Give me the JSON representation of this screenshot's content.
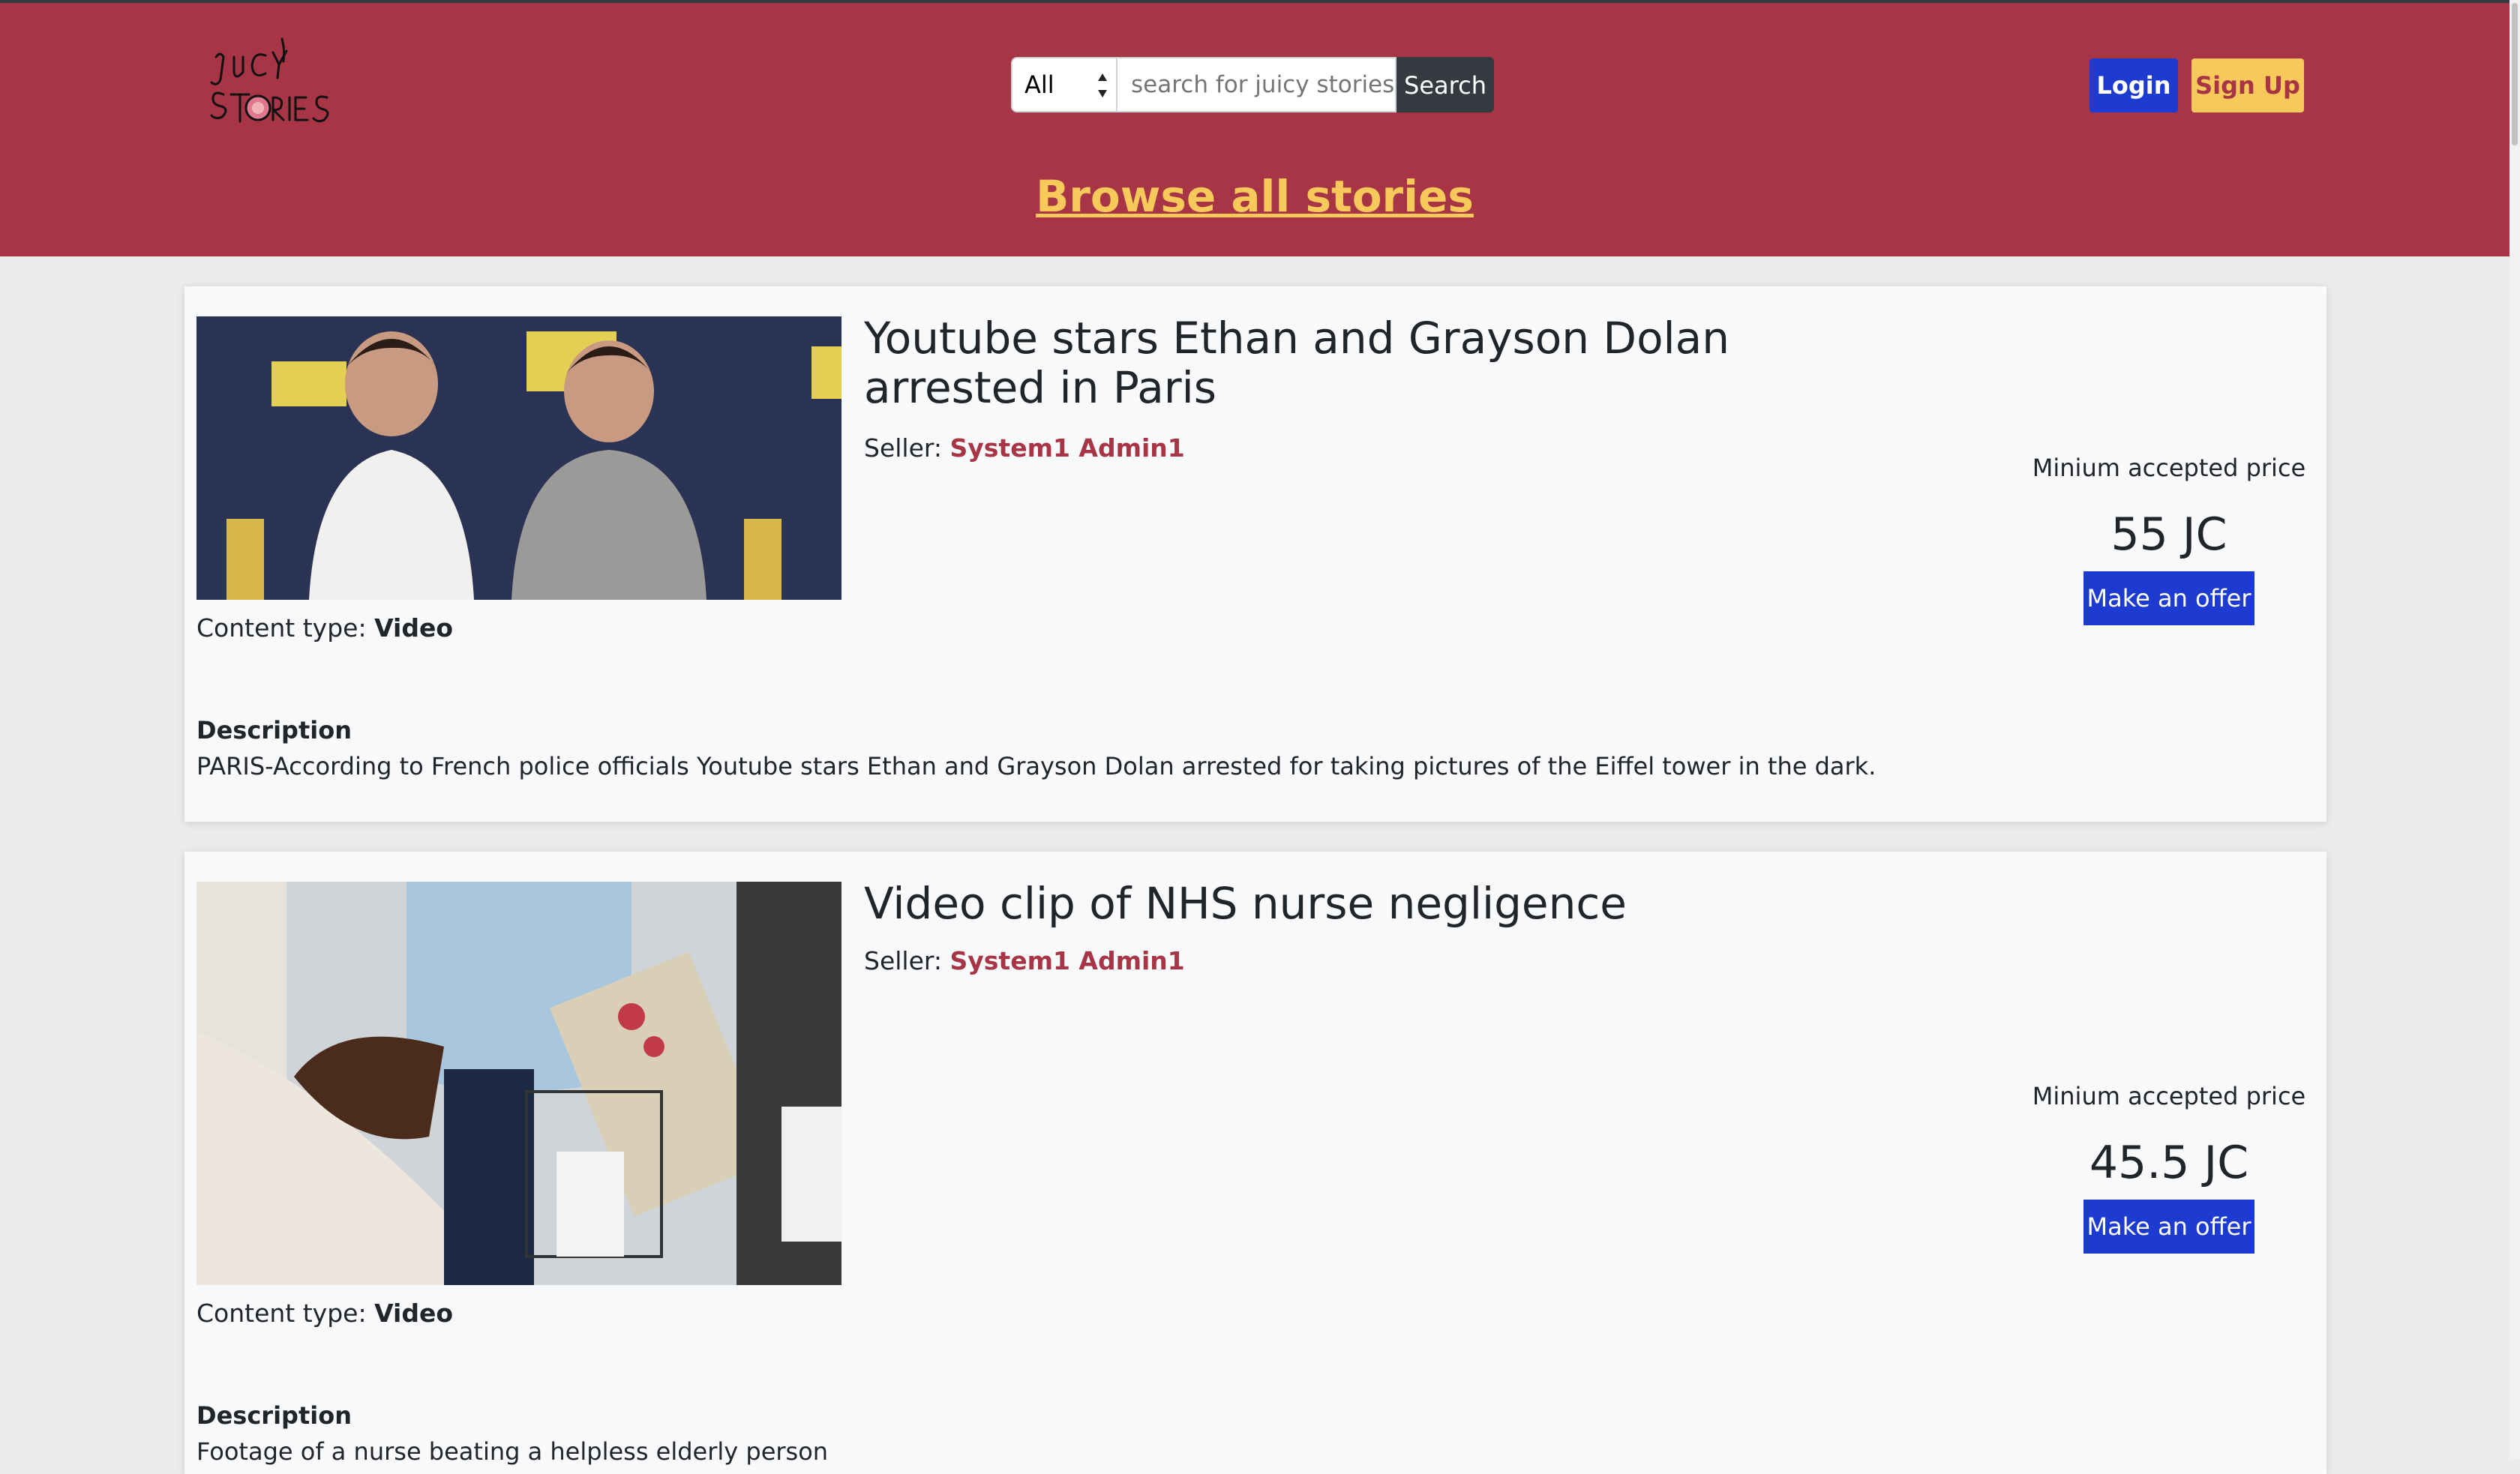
{
  "header": {
    "logo_text": "JUICY STORIES",
    "search": {
      "category_value": "All",
      "placeholder": "search for juicy stories",
      "button_label": "Search"
    },
    "login_label": "Login",
    "signup_label": "Sign Up",
    "browse_label": "Browse all stories"
  },
  "stories": [
    {
      "title": "Youtube stars Ethan and Grayson Dolan arrested in Paris",
      "seller_prefix": "Seller:",
      "seller_name": "System1 Admin1",
      "price_label": "Minium accepted price",
      "price": "55 JC",
      "offer_label": "Make an offer",
      "content_type_prefix": "Content type:",
      "content_type": "Video",
      "description_label": "Description",
      "description": "PARIS-According to French police officials Youtube stars Ethan and Grayson Dolan arrested for taking pictures of the Eiffel tower in the dark."
    },
    {
      "title": "Video clip of NHS nurse negligence",
      "seller_prefix": "Seller:",
      "seller_name": "System1 Admin1",
      "price_label": "Minium accepted price",
      "price": "45.5 JC",
      "offer_label": "Make an offer",
      "content_type_prefix": "Content type:",
      "content_type": "Video",
      "description_label": "Description",
      "description": "Footage of a nurse beating a helpless elderly person"
    }
  ],
  "colors": {
    "header_bg": "#a73545",
    "primary_button": "#1d3bd1",
    "accent_yellow": "#f7c85a",
    "dark_button": "#343a40"
  }
}
